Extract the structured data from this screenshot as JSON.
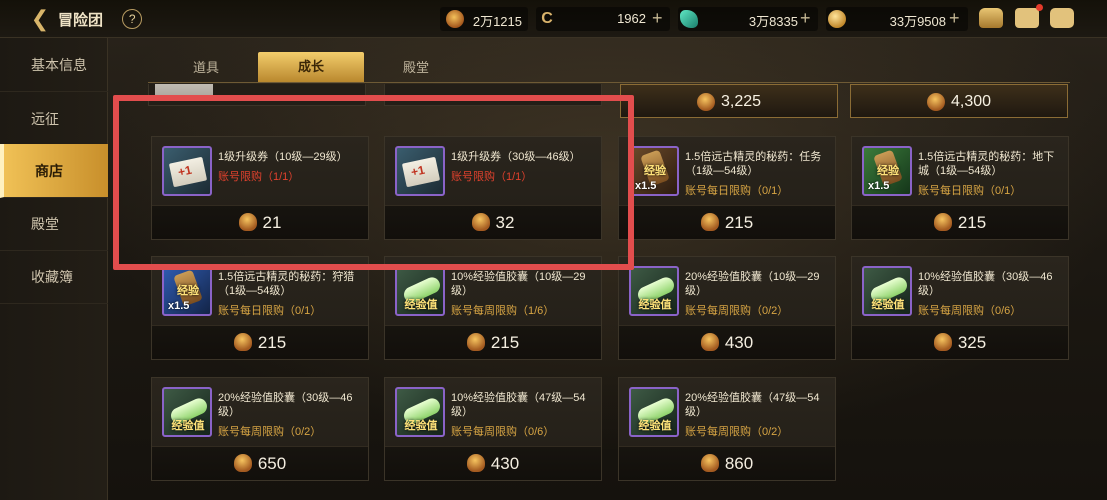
{
  "header": {
    "title": "冒险团",
    "help": "?",
    "currencies": [
      {
        "icon": "trophy-icon",
        "value": "2万1215"
      },
      {
        "icon": "c-coin-icon",
        "symbol": "C",
        "value": "1962",
        "plus": "+"
      },
      {
        "icon": "gem-icon",
        "value": "3万8335",
        "plus": "+"
      },
      {
        "icon": "gold-coin-icon",
        "value": "33万9508",
        "plus": "+"
      }
    ]
  },
  "sidebar": {
    "items": [
      {
        "label": "基本信息"
      },
      {
        "label": "远征"
      },
      {
        "label": "商店"
      },
      {
        "label": "殿堂"
      },
      {
        "label": "收藏簿"
      }
    ],
    "active_index": 2
  },
  "tabs": [
    {
      "label": "道具"
    },
    {
      "label": "成长"
    },
    {
      "label": "殿堂"
    }
  ],
  "active_tab_index": 1,
  "partial_row": [
    {
      "price": "3,225"
    },
    {
      "price": "4,300"
    }
  ],
  "items": [
    {
      "name": "1级升级券（10级—29级）",
      "limit": "账号限购（1/1）",
      "price": "21",
      "icon": "ticket"
    },
    {
      "name": "1级升级券（30级—46级）",
      "limit": "账号限购（1/1）",
      "price": "32",
      "icon": "ticket"
    },
    {
      "name": "1.5倍远古精灵的秘药：任务（1级—54级）",
      "limit": "账号每日限购（0/1）",
      "price": "215",
      "icon": "potion"
    },
    {
      "name": "1.5倍远古精灵的秘药：地下城（1级—54级）",
      "limit": "账号每日限购（0/1）",
      "price": "215",
      "icon": "potion-dungeon"
    },
    {
      "name": "1.5倍远古精灵的秘药：狩猎（1级—54级）",
      "limit": "账号每日限购（0/1）",
      "price": "215",
      "icon": "potion-hunt"
    },
    {
      "name": "10%经验值胶囊（10级—29级）",
      "limit": "账号每周限购（1/6）",
      "price": "215",
      "icon": "capsule"
    },
    {
      "name": "20%经验值胶囊（10级—29级）",
      "limit": "账号每周限购（0/2）",
      "price": "430",
      "icon": "capsule"
    },
    {
      "name": "10%经验值胶囊（30级—46级）",
      "limit": "账号每周限购（0/6）",
      "price": "325",
      "icon": "capsule"
    },
    {
      "name": "20%经验值胶囊（30级—46级）",
      "limit": "账号每周限购（0/2）",
      "price": "650",
      "icon": "capsule"
    },
    {
      "name": "10%经验值胶囊（47级—54级）",
      "limit": "账号每周限购（0/6）",
      "price": "430",
      "icon": "capsule"
    },
    {
      "name": "20%经验值胶囊（47级—54级）",
      "limit": "账号每周限购（0/2）",
      "price": "860",
      "icon": "capsule"
    }
  ],
  "icon_labels": {
    "exp": "经验",
    "exp_value": "经验值"
  },
  "colors": {
    "accent_gold": "#f0c156",
    "limit_red": "#e0412d",
    "limit_orange": "#d7a544",
    "highlight_red": "#e24d4d"
  }
}
